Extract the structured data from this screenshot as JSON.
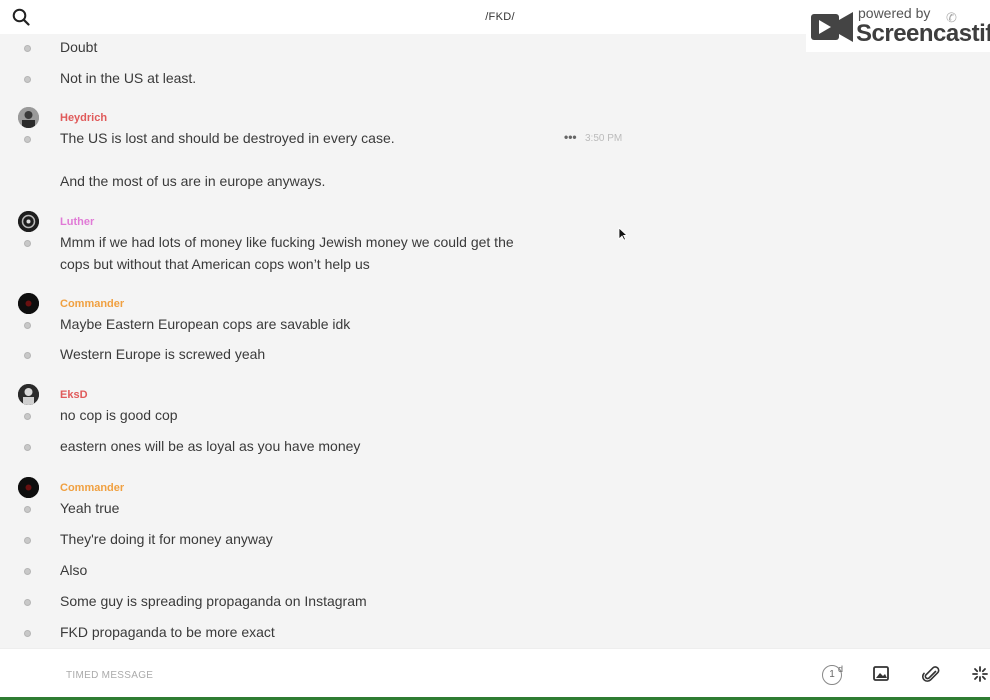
{
  "header": {
    "search_icon": "search-icon",
    "channel": "/FKD/"
  },
  "watermark": {
    "powered_by": "powered by",
    "brand": "Screencastify"
  },
  "messages": [
    {
      "text": "Doubt"
    },
    {
      "text": "Not in the US at least."
    },
    {
      "author": "Heydrich",
      "author_color": "#e05a5a",
      "text": "The US  is lost and should be destroyed in every case.",
      "time": "3:50 PM"
    },
    {
      "text": "And the most of us are in europe anyways."
    },
    {
      "author": "Luther",
      "author_color": "#e07ad6",
      "text": "Mmm if we had lots of money like fucking Jewish money we could get the cops but without that American cops won’t help us"
    },
    {
      "author": "Commander",
      "author_color": "#f0a040",
      "text": "Maybe Eastern European cops are savable idk"
    },
    {
      "text": "Western Europe is screwed yeah"
    },
    {
      "author": "EksD",
      "author_color": "#e05a5a",
      "text": "no cop is good cop"
    },
    {
      "text": "eastern ones will be as loyal as you have money"
    },
    {
      "author": "Commander",
      "author_color": "#f0a040",
      "text": "Yeah true"
    },
    {
      "text": "They're doing it for money anyway"
    },
    {
      "text": "Also"
    },
    {
      "text": "Some guy is spreading propaganda on Instagram"
    },
    {
      "text": "FKD propaganda to be more exact"
    }
  ],
  "composer": {
    "placeholder": "TIMED MESSAGE",
    "timer_value": "1",
    "timer_unit": "d"
  },
  "colors": {
    "background": "#f4f4f4",
    "bar": "#ffffff",
    "heydrich": "#e05a5a",
    "luther": "#e07ad6",
    "commander": "#f0a040",
    "eksd": "#e05a5a"
  }
}
